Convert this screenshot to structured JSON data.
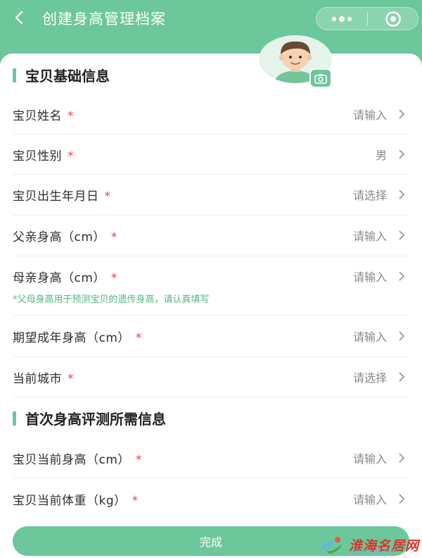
{
  "nav": {
    "back_icon": "chevron-left-icon",
    "title": "创建身高管理档案"
  },
  "section1": {
    "title": "宝贝基础信息",
    "rows": [
      {
        "label": "宝贝姓名",
        "required": "*",
        "value": "请输入"
      },
      {
        "label": "宝贝性别",
        "required": "*",
        "value": "男"
      },
      {
        "label": "宝贝出生年月日",
        "required": "*",
        "value": "请选择"
      },
      {
        "label": "父亲身高（cm）",
        "required": "*",
        "value": "请输入"
      },
      {
        "label": "母亲身高（cm）",
        "required": "*",
        "value": "请输入"
      },
      {
        "label": "期望成年身高（cm）",
        "required": "*",
        "value": "请输入"
      },
      {
        "label": "当前城市",
        "required": "*",
        "value": "请选择"
      }
    ],
    "hint": "*父母身高用于预测宝贝的遗传身高，请认真填写"
  },
  "section2": {
    "title": "首次身高评测所需信息",
    "rows": [
      {
        "label": "宝贝当前身高（cm）",
        "required": "*",
        "value": "请输入"
      },
      {
        "label": "宝贝当前体重（kg）",
        "required": "*",
        "value": "请输入"
      }
    ]
  },
  "finish_label": "完成",
  "watermark": {
    "text": "淮海名居网",
    "url": "www.xzjk.com"
  },
  "colors": {
    "accent": "#6cc79a",
    "required": "#e0444f",
    "hint": "#52b883"
  }
}
